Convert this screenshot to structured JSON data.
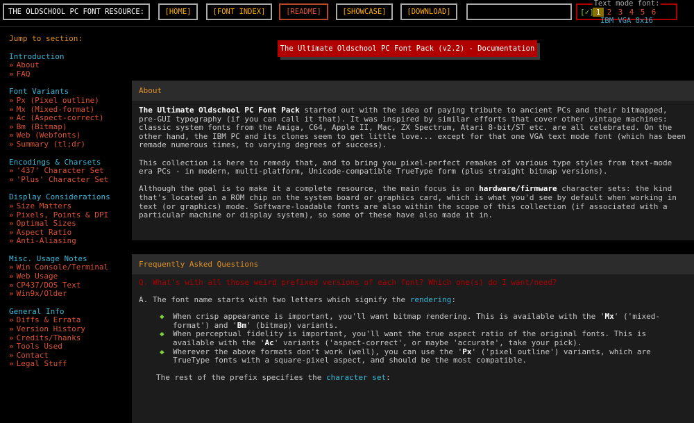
{
  "header": {
    "site_title": "THE OLDSCHOOL PC FONT RESOURCE:",
    "nav": [
      {
        "label": "[HOME]",
        "active": false
      },
      {
        "label": "[FONT INDEX]",
        "active": false
      },
      {
        "label": "[README]",
        "active": true
      },
      {
        "label": "[SHOWCASE]",
        "active": false
      },
      {
        "label": "[DOWNLOAD]",
        "active": false
      }
    ],
    "font_selector": {
      "label": "Text mode font:",
      "check": "[✓]",
      "options": [
        "1",
        "2",
        "3",
        "4",
        "5",
        "6"
      ],
      "selected": "1",
      "current_font": "IBM VGA 8x16"
    }
  },
  "sidebar": {
    "jump_label": "Jump to section:",
    "sections": [
      {
        "heading": "Introduction",
        "items": [
          "About",
          "FAQ"
        ]
      },
      {
        "heading": "Font Variants",
        "items": [
          "Px (Pixel outline)",
          "Mx (Mixed-format)",
          "Ac (Aspect-correct)",
          "Bm (Bitmap)",
          "Web (Webfonts)",
          "Summary (tl;dr)"
        ]
      },
      {
        "heading": "Encodings & Charsets",
        "items": [
          "'437' Character Set",
          "'Plus' Character Set"
        ]
      },
      {
        "heading": "Display Considerations",
        "items": [
          "Size Matters",
          "Pixels, Points & DPI",
          "Optimal Sizes",
          "Aspect Ratio",
          "Anti-Aliasing"
        ]
      },
      {
        "heading": "Misc. Usage Notes",
        "items": [
          "Win Console/Terminal",
          "Web Usage",
          "CP437/DOS Text",
          "Win9x/Older"
        ]
      },
      {
        "heading": "General Info",
        "items": [
          "Diffs & Errata",
          "Version History",
          "Credits/Thanks",
          "Tools Used",
          "Contact",
          "Legal Stuff"
        ]
      }
    ],
    "bullet": "»"
  },
  "doc_title": "The Ultimate Oldschool PC Font Pack (v2.2) - Documentation",
  "about": {
    "heading": "About",
    "p1_bold": "The Ultimate Oldschool PC Font Pack",
    "p1_rest": " started out with the idea of paying tribute to ancient PCs and their bitmapped, pre-GUI typography (if you can call it that). It was inspired by similar efforts that cover other vintage machines: classic system fonts from the Amiga, C64, Apple II, Mac, ZX Spectrum, Atari 8-bit/ST etc. are all celebrated. On the other hand, the IBM PC and its clones seem to get little love... except for that one VGA text mode font (which has been remade numerous times, to varying degrees of success).",
    "p2": "This collection is here to remedy that, and to bring you pixel-perfect remakes of various type styles from text-mode era PCs - in modern, multi-platform, Unicode-compatible TrueType form (plus straight bitmap versions).",
    "p3_a": "Although the goal is to make it a complete resource, the main focus is on ",
    "p3_bold": "hardware/firmware",
    "p3_b": " character sets: the kind that's located in a ROM chip on the system board or graphics card, which is what you'd see by default when working in text (or graphics) mode. Software-loadable fonts are also within the scope of this collection (if associated with a particular machine or display system), so some of these have also made it in."
  },
  "faq": {
    "heading": "Frequently Asked Questions",
    "question": "Q. What's with all those weird prefixed versions of each font? Which one(s) do I want/need?",
    "answer_a": "A. The font name starts with two letters which signify the ",
    "answer_link": "rendering",
    "answer_b": ":",
    "bullets": [
      {
        "a": "When crisp appearance is important, you'll want bitmap rendering. This is available with the '",
        "b1": "Mx",
        "c": "' ('mixed-format') and '",
        "b2": "Bm",
        "d": "' (bitmap) variants."
      },
      {
        "a": "When perceptual fidelity is important, you'll want the true aspect ratio of the original fonts. This is available with the '",
        "b1": "Ac",
        "c": "' variants ('aspect-correct', or maybe 'accurate', take your pick).",
        "b2": "",
        "d": ""
      },
      {
        "a": "Wherever the above formats don't work (well), you can use the '",
        "b1": "Px",
        "c": "' ('pixel outline') variants, which are TrueType fonts with a square-pixel aspect, and should be the most compatible.",
        "b2": "",
        "d": ""
      }
    ],
    "rest_a": "The rest of the prefix specifies the ",
    "rest_link": "character set",
    "rest_b": ":",
    "diamond": "◆"
  }
}
